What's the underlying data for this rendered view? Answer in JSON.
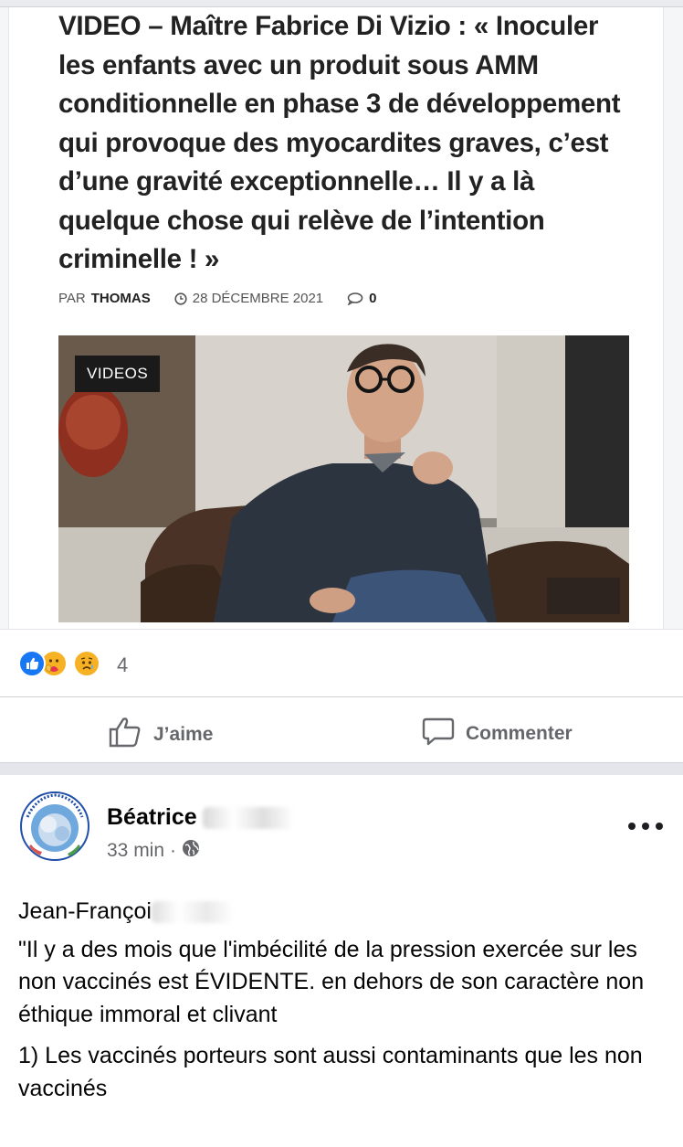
{
  "article": {
    "headline": "VIDEO – Maître Fabrice Di Vizio : « Inoculer les enfants avec un produit sous AMM conditionnelle en phase 3 de développement qui provoque des myocardites graves, c’est d’une gravité exceptionnelle… Il y a là quelque chose qui relève de l’intention criminelle ! »",
    "by_prefix": "PAR",
    "author": "THOMAS",
    "date": "28 DÉCEMBRE 2021",
    "comments": "0",
    "video_badge": "VIDEOS"
  },
  "reactions": {
    "icons": [
      "like-reaction-icon",
      "care-reaction-icon",
      "sad-reaction-icon"
    ],
    "count": "4"
  },
  "actions": {
    "like_label": "J’aime",
    "comment_label": "Commenter"
  },
  "post": {
    "author_visible": "Béatrice",
    "time": "33 min",
    "mention_visible": "Jean-Françoi",
    "paragraph_1": "\"Il y a des mois que l'imbécilité de la pression exercée sur les non vaccinés est ÉVIDENTE. en dehors de son caractère non éthique immoral et clivant",
    "paragraph_2": "1) Les vaccinés porteurs sont aussi contaminants que les non vaccinés"
  },
  "colors": {
    "like_blue": "#1877f2",
    "care_yellow": "#f7b125",
    "secondary_text": "#65676b"
  }
}
